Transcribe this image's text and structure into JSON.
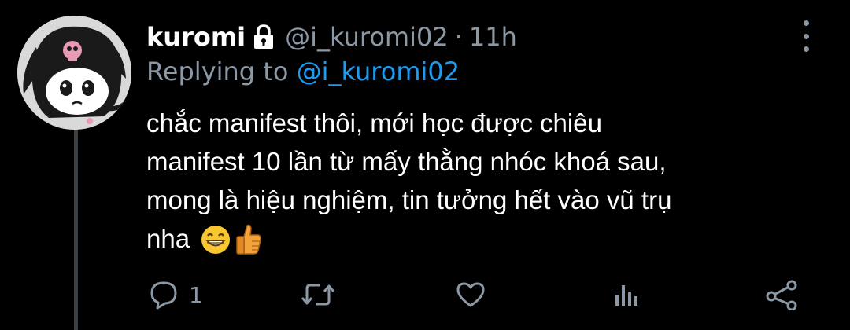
{
  "author": {
    "name": "kuromi",
    "handle": "@i_kuromi02",
    "separator": "·",
    "time": "11h",
    "protected_icon": "lock-icon"
  },
  "reply": {
    "prefix": "Replying to",
    "target": "@i_kuromi02"
  },
  "tweet": {
    "lines": [
      "chắc manifest thôi, mới học được chiêu",
      "manifest 10 lần từ mấy thằng nhóc khoá sau,",
      "mong là hiệu nghiệm, tin tưởng hết vào vũ trụ",
      "nha"
    ],
    "emojis": [
      "grinning-face-emoji",
      "thumbs-up-emoji"
    ]
  },
  "actions": {
    "reply": {
      "icon": "reply-icon",
      "count": "1"
    },
    "retweet": {
      "icon": "retweet-icon"
    },
    "like": {
      "icon": "heart-icon"
    },
    "analytics": {
      "icon": "analytics-icon"
    },
    "share": {
      "icon": "share-icon"
    }
  },
  "colors": {
    "background": "#000000",
    "text": "#ffffff",
    "muted": "#8b98a5",
    "accent": "#1d9bf0",
    "thread_line": "#3a3f44"
  }
}
